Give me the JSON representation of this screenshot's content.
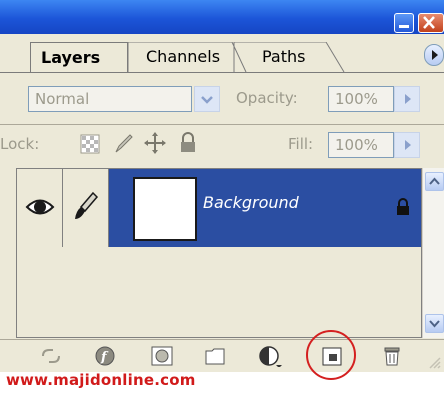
{
  "tabs": {
    "layers": "Layers",
    "channels": "Channels",
    "paths": "Paths"
  },
  "blend": {
    "mode": "Normal",
    "opacity_label": "Opacity:",
    "opacity_value": "100%"
  },
  "lock": {
    "label": "Lock:",
    "fill_label": "Fill:",
    "fill_value": "100%"
  },
  "layer": {
    "name": "Background"
  },
  "footer": {
    "watermark": "www.majidonline.com"
  },
  "colors": {
    "titlebar": "#1c55d8",
    "selected_row": "#2b4ea2",
    "panel": "#ece9d8",
    "highlight_circle": "#d42020",
    "watermark": "#d11a1a"
  },
  "icons": {
    "titlebar": [
      "minimize-icon",
      "close-icon"
    ],
    "lock": [
      "lock-transparent-icon",
      "lock-brush-icon",
      "lock-move-icon",
      "lock-all-icon"
    ],
    "bottom": [
      "link-layers-icon",
      "layer-style-icon",
      "layer-mask-icon",
      "new-group-icon",
      "adjustment-layer-icon",
      "new-layer-icon",
      "delete-layer-icon"
    ]
  }
}
